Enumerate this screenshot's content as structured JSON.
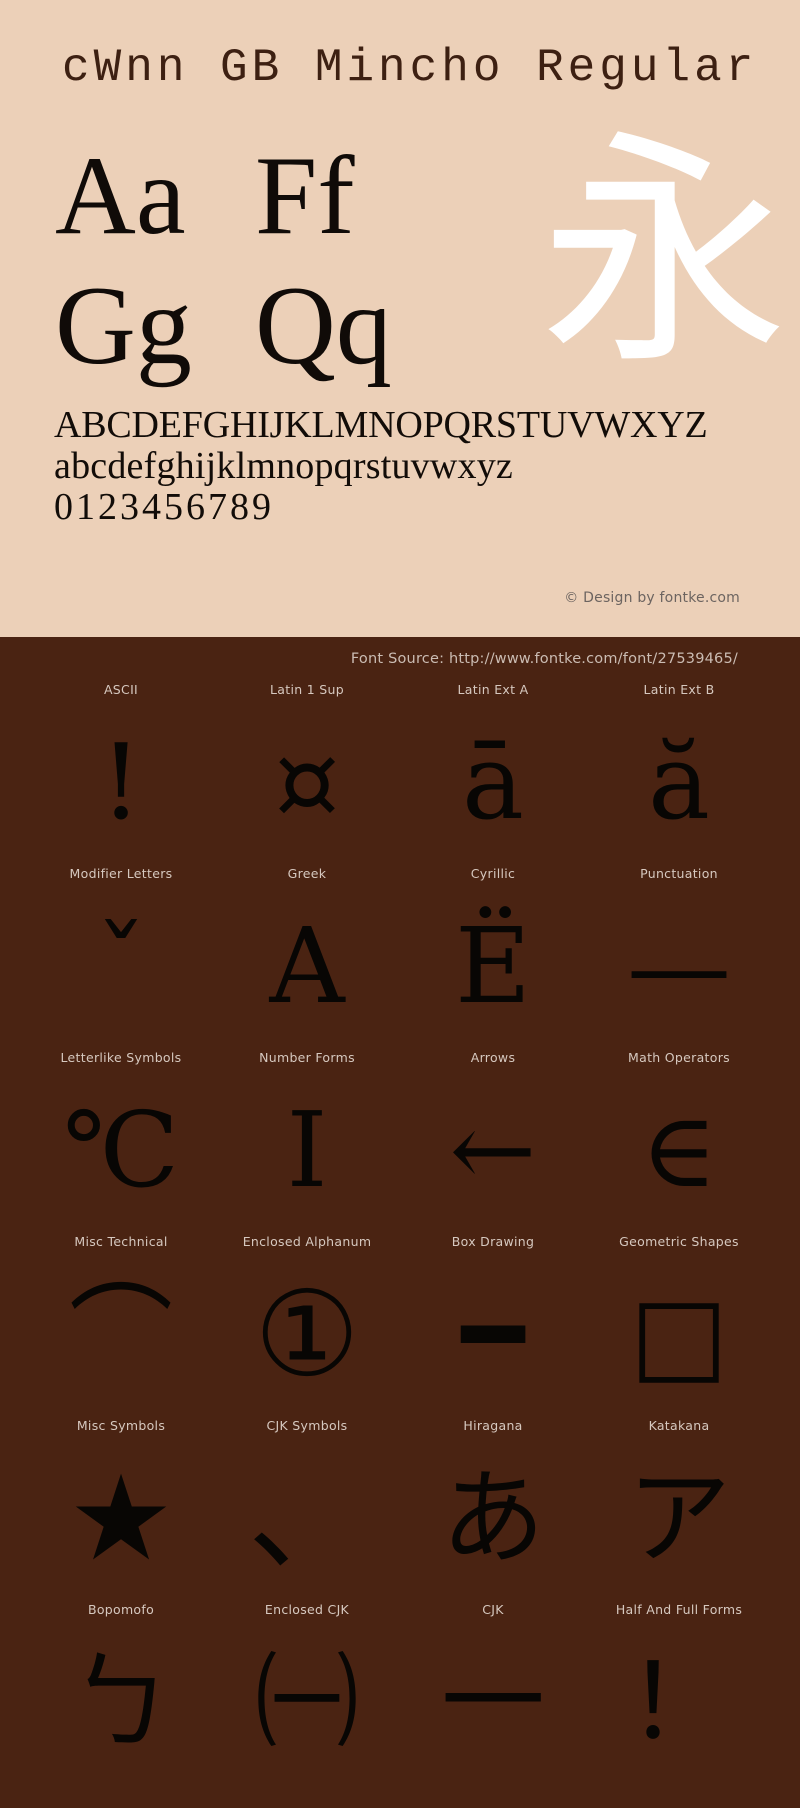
{
  "specimen": {
    "font_title": "cWnn GB Mincho Regular",
    "sample_pairs": [
      [
        "Aa",
        "Ff"
      ],
      [
        "Gg",
        "Qq"
      ]
    ],
    "hero_glyph": "永",
    "uppercase": "ABCDEFGHIJKLMNOPQRSTUVWXYZ",
    "lowercase": "abcdefghijklmnopqrstuvwxyz",
    "digits": "0123456789",
    "credit": "© Design by fontke.com",
    "colors": {
      "specimen_background": "#ecd0b8",
      "specimen_text": "#120c08",
      "hero_glyph": "#ffffff",
      "coverage_background": "#4a2312",
      "coverage_label": "#d6c8bf",
      "coverage_glyph": "#080604"
    }
  },
  "coverage": {
    "source_label": "Font Source: http://www.fontke.com/font/27539465/",
    "blocks": [
      {
        "label": "ASCII",
        "glyph": "!",
        "icon": "exclamation-mark-glyph",
        "size": "lg"
      },
      {
        "label": "Latin 1 Sup",
        "glyph": "¤",
        "icon": "currency-sign-glyph",
        "size": "lg"
      },
      {
        "label": "Latin Ext A",
        "glyph": "ā",
        "icon": "a-macron-glyph",
        "size": "lg"
      },
      {
        "label": "Latin Ext B",
        "glyph": "ă",
        "icon": "a-breve-glyph",
        "size": "lg"
      },
      {
        "label": "Modifier Letters",
        "glyph": "ˇ",
        "icon": "caron-modifier-glyph",
        "size": "lg"
      },
      {
        "label": "Greek",
        "glyph": "Α",
        "icon": "greek-capital-alpha-glyph",
        "size": "lg"
      },
      {
        "label": "Cyrillic",
        "glyph": "Ё",
        "icon": "cyrillic-capital-io-glyph",
        "size": "lg"
      },
      {
        "label": "Punctuation",
        "glyph": "—",
        "icon": "em-dash-glyph",
        "size": "lg"
      },
      {
        "label": "Letterlike Symbols",
        "glyph": "℃",
        "icon": "degree-celsius-glyph",
        "size": "lg"
      },
      {
        "label": "Number Forms",
        "glyph": "Ⅰ",
        "icon": "roman-numeral-one-glyph",
        "size": "lg"
      },
      {
        "label": "Arrows",
        "glyph": "←",
        "icon": "leftwards-arrow-glyph",
        "size": "lg"
      },
      {
        "label": "Math Operators",
        "glyph": "∈",
        "icon": "element-of-glyph",
        "size": "lg"
      },
      {
        "label": "Misc Technical",
        "glyph": "⌒",
        "icon": "arc-glyph",
        "size": "lg"
      },
      {
        "label": "Enclosed Alphanum",
        "glyph": "①",
        "icon": "circled-digit-one-glyph",
        "size": "xl"
      },
      {
        "label": "Box Drawing",
        "glyph": "━",
        "icon": "box-drawing-heavy-horizontal-glyph",
        "size": "lg"
      },
      {
        "label": "Geometric Shapes",
        "glyph": "□",
        "icon": "white-square-glyph",
        "size": "lg"
      },
      {
        "label": "Misc Symbols",
        "glyph": "★",
        "icon": "black-star-glyph",
        "size": "xl"
      },
      {
        "label": "CJK Symbols",
        "glyph": "、",
        "icon": "ideographic-comma-glyph",
        "size": "xl"
      },
      {
        "label": "Hiragana",
        "glyph": "あ",
        "icon": "hiragana-a-glyph",
        "size": "lg"
      },
      {
        "label": "Katakana",
        "glyph": "ア",
        "icon": "katakana-a-glyph",
        "size": "lg"
      },
      {
        "label": "Bopomofo",
        "glyph": "ㄅ",
        "icon": "bopomofo-b-glyph",
        "size": "lg"
      },
      {
        "label": "Enclosed CJK",
        "glyph": "㈠",
        "icon": "parenthesized-ideograph-one-glyph",
        "size": "lg"
      },
      {
        "label": "CJK",
        "glyph": "一",
        "icon": "cjk-ideograph-one-glyph",
        "size": "lg"
      },
      {
        "label": "Half And Full Forms",
        "glyph": "！",
        "icon": "fullwidth-exclamation-glyph",
        "size": "lg"
      }
    ]
  }
}
